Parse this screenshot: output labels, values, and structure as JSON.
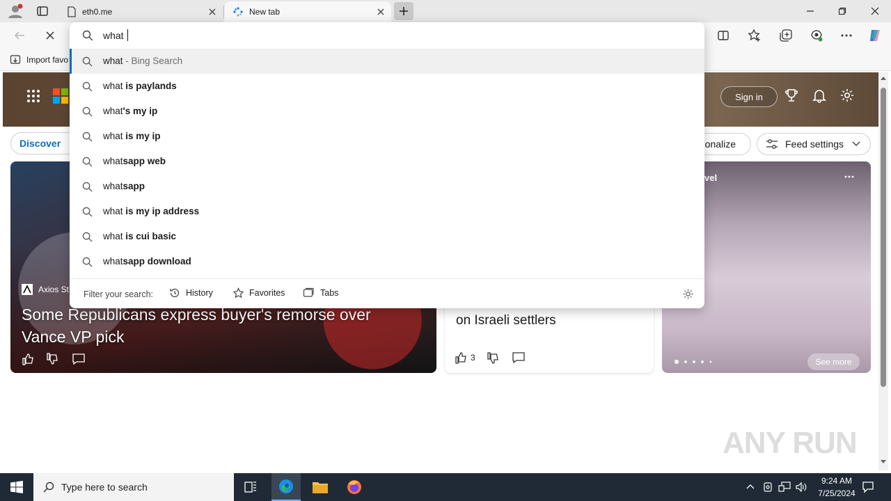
{
  "tabs": [
    {
      "title": "eth0.me"
    },
    {
      "title": "New tab"
    }
  ],
  "favorites_bar": {
    "import_label": "Import favo"
  },
  "omnibox": {
    "query": "what ",
    "suggestions": [
      {
        "typed": "what",
        "completion": "",
        "suffix": " - Bing Search"
      },
      {
        "typed": "what ",
        "completion": "is paylands",
        "suffix": ""
      },
      {
        "typed": "what",
        "completion": "'s my ip",
        "suffix": ""
      },
      {
        "typed": "what ",
        "completion": "is my ip",
        "suffix": ""
      },
      {
        "typed": "what",
        "completion": "sapp web",
        "suffix": ""
      },
      {
        "typed": "what",
        "completion": "sapp",
        "suffix": ""
      },
      {
        "typed": "what ",
        "completion": "is my ip address",
        "suffix": ""
      },
      {
        "typed": "what ",
        "completion": "is cui basic",
        "suffix": ""
      },
      {
        "typed": "what",
        "completion": "sapp download",
        "suffix": ""
      }
    ],
    "filter_label": "Filter your search:",
    "filters": [
      {
        "label": "History"
      },
      {
        "label": "Favorites"
      },
      {
        "label": "Tabs"
      }
    ]
  },
  "newtab": {
    "sign_in": "Sign in",
    "discover": "Discover",
    "personalize": "rsonalize",
    "feed_settings": "Feed settings",
    "main_headline": "Some Republicans express buyer's remorse over Vance VP pick",
    "main_source": "Axios St",
    "mid_headline": "on Israeli settlers",
    "mid_likes": "3",
    "right_category": "vel",
    "see_more": "See more"
  },
  "watermark": "ANY RUN",
  "taskbar": {
    "search_placeholder": "Type here to search",
    "time": "9:24 AM",
    "date": "7/25/2024"
  }
}
